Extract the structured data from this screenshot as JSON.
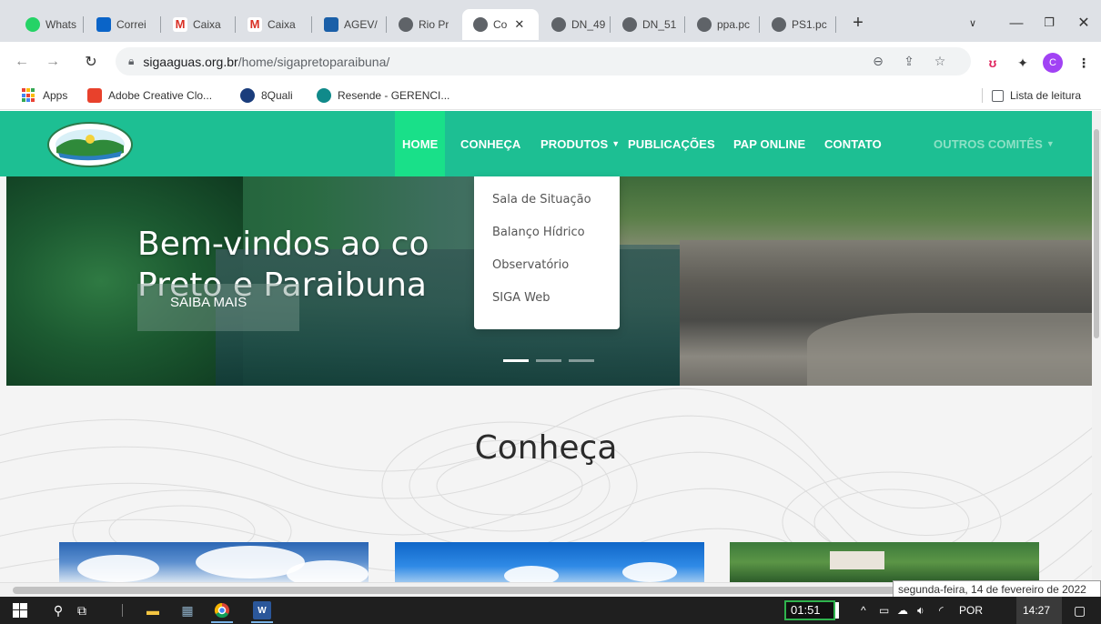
{
  "browser": {
    "tabs": [
      {
        "title": "Whats",
        "favicon": "whatsapp-icon"
      },
      {
        "title": "Correi",
        "favicon": "outlook-icon"
      },
      {
        "title": "Caixa",
        "favicon": "gmail-icon"
      },
      {
        "title": "Caixa",
        "favicon": "gmail-icon"
      },
      {
        "title": "AGEV/",
        "favicon": "agevap-icon"
      },
      {
        "title": "Rio Pr",
        "favicon": "globe-icon"
      },
      {
        "title": "Co",
        "favicon": "globe-icon",
        "active": true
      },
      {
        "title": "DN_49",
        "favicon": "globe-icon"
      },
      {
        "title": "DN_51",
        "favicon": "globe-icon"
      },
      {
        "title": "ppa.pc",
        "favicon": "globe-icon"
      },
      {
        "title": "PS1.pc",
        "favicon": "globe-icon"
      }
    ],
    "new_tab_glyph": "+",
    "url_host": "sigaaguas.org.br",
    "url_path": "/home/sigapretoparaibuna/",
    "profile_initial": "C",
    "bookmarks": [
      {
        "label": "Apps",
        "icon": "apps-grid-icon"
      },
      {
        "label": "Adobe Creative Clo...",
        "icon": "adobe-icon"
      },
      {
        "label": "8Quali",
        "icon": "8quali-icon"
      },
      {
        "label": "Resende - GERENCI...",
        "icon": "sharepoint-icon"
      }
    ],
    "reading_list": "Lista de leitura"
  },
  "site": {
    "nav": {
      "home": "HOME",
      "conheca": "CONHEÇA",
      "produtos": "PRODUTOS",
      "publicacoes": "PUBLICAÇÕES",
      "pap_online": "PAP ONLINE",
      "contato": "CONTATO",
      "outros": "OUTROS COMITÊS"
    },
    "dropdown": [
      "Sala de Situação",
      "Balanço Hídrico",
      "Observatório",
      "SIGA Web"
    ],
    "hero": {
      "line1": "Bem-vindos ao co",
      "line2": "Preto e Paraibuna",
      "button": "SAIBA MAIS"
    },
    "section_title": "Conheça"
  },
  "tooltip": "segunda-feira, 14 de fevereiro de 2022",
  "taskbar": {
    "timer": "01:51",
    "language": "POR",
    "time": "14:27"
  },
  "colors": {
    "nav_green": "#1dbf93",
    "home_active": "#19e089"
  }
}
